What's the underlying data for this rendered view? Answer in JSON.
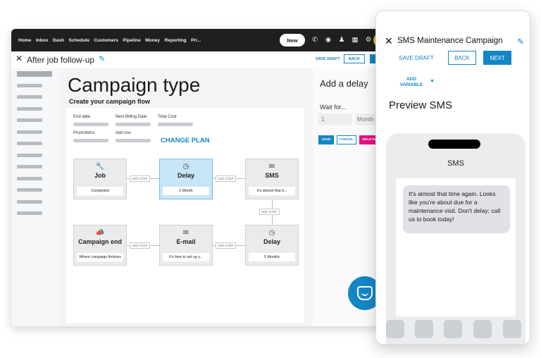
{
  "nav": {
    "items": [
      "Home",
      "Inbox",
      "Dash",
      "Schedule",
      "Customers",
      "Pipeline",
      "Money",
      "Reporting",
      "Pri..."
    ],
    "new_label": "New"
  },
  "campaign": {
    "title": "After job follow-up",
    "save_draft": "SAVE DRAFT",
    "back": "BACK"
  },
  "canvas": {
    "heading": "Campaign type",
    "subheading": "Create your campaign flow",
    "info": {
      "end_date": "End date",
      "next_billing": "Next Billing Date",
      "total_cost": "Total Cost",
      "promotions": "Promotions",
      "add_ons": "Add ons",
      "change_plan": "CHANGE PLAN"
    },
    "add_step": "ADD STEP",
    "nodes": [
      {
        "title": "Job",
        "detail": "Completed"
      },
      {
        "title": "Delay",
        "detail": "1 Month"
      },
      {
        "title": "SMS",
        "detail": "It's almost that ti..."
      },
      {
        "title": "Campaign end",
        "detail": "Where campaign finishes"
      },
      {
        "title": "E-mail",
        "detail": "It's time to set up y..."
      },
      {
        "title": "Delay",
        "detail": "5 Months"
      }
    ]
  },
  "delay_panel": {
    "title": "Add a delay",
    "wait_label": "Wait for...",
    "amount": "1",
    "unit": "Month",
    "save": "SAVE",
    "cancel": "CANCEL",
    "delete": "DELETE"
  },
  "sms_panel": {
    "title": "SMS Maintenance Campaign",
    "save_draft": "SAVE DRAFT",
    "back": "BACK",
    "next": "NEXT",
    "add_variable": "ADD VARIABLE",
    "preview_title": "Preview SMS",
    "contact": "SMS",
    "message": "It's almost that time again. Looks like you're about due for a maintenance visit. Don't delay; call us to book today!"
  },
  "colors": {
    "accent": "#1486c6",
    "delete": "#e6127f",
    "nav_bg": "#1f1f1f",
    "active_node": "#c7e5f6"
  }
}
